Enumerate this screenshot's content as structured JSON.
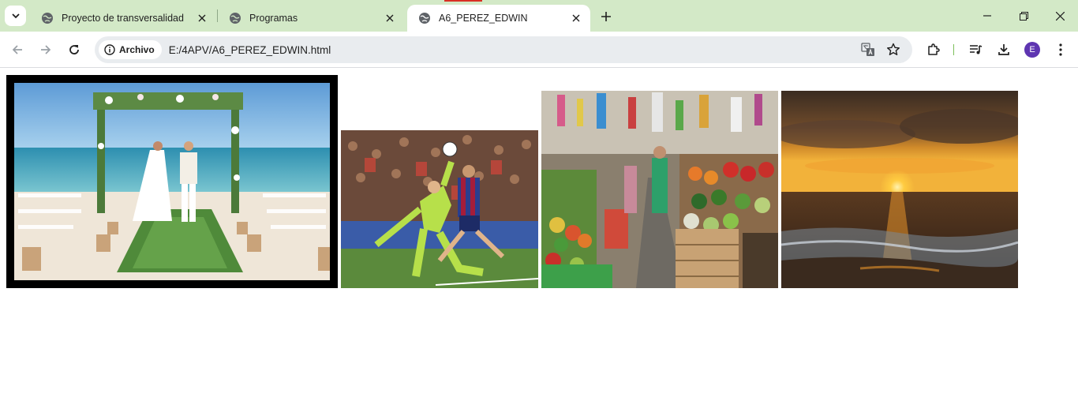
{
  "tabs": [
    {
      "title": "Proyecto de transversalidad",
      "active": false
    },
    {
      "title": "Programas",
      "active": false
    },
    {
      "title": "A6_PEREZ_EDWIN",
      "active": true
    }
  ],
  "toolbar": {
    "chip_label": "Archivo",
    "url": "E:/4APV/A6_PEREZ_EDWIN.html",
    "avatar_letter": "E"
  },
  "colors": {
    "tabstrip": "#d3e9c7",
    "avatar": "#5e35b1"
  },
  "icons": [
    "tab-search-icon",
    "globe-icon",
    "close-icon",
    "plus-icon",
    "minimize-icon",
    "restore-icon",
    "window-close-icon",
    "back-icon",
    "forward-icon",
    "reload-icon",
    "info-icon",
    "translate-icon",
    "star-icon",
    "extensions-icon",
    "media-icon",
    "download-icon",
    "menu-icon"
  ],
  "images": [
    {
      "subject": "beach-wedding"
    },
    {
      "subject": "soccer-goal"
    },
    {
      "subject": "market-stalls"
    },
    {
      "subject": "sea-sunset"
    }
  ]
}
